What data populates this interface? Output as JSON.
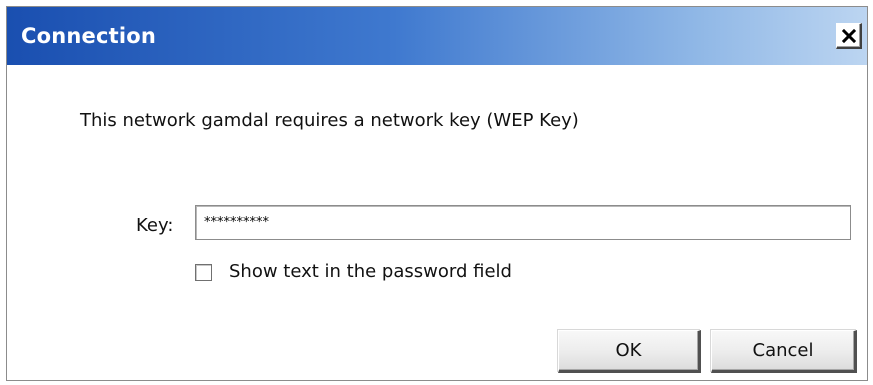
{
  "window": {
    "title": "Connection",
    "close_symbol": "close-icon"
  },
  "dialog": {
    "message": "This network gamdal requires a network key (WEP Key)",
    "key_label": "Key:",
    "key_value": "**********",
    "show_text_label": "Show text in the password field",
    "show_text_checked": false,
    "ok_label": "OK",
    "cancel_label": "Cancel"
  },
  "colors": {
    "titlebar_start": "#1a4fb0",
    "titlebar_end": "#bcd5f1",
    "title_text": "#ffffff"
  }
}
